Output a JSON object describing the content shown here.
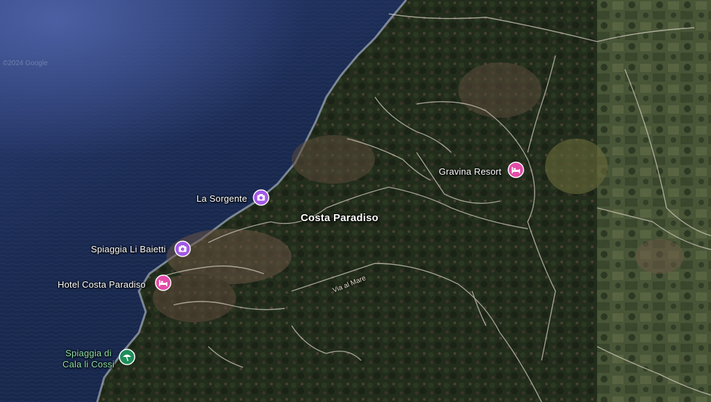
{
  "map": {
    "place_labels": {
      "town": "Costa Paradiso",
      "la_sorgente": "La Sorgente",
      "li_baietti": "Spiaggia Li Baietti",
      "hotel": "Hotel Costa Paradiso",
      "cala_li_cossi_1": "Spiaggia di",
      "cala_li_cossi_2": "Cala li Cossi",
      "gravina": "Gravina Resort"
    },
    "road_label": "Via al Mare",
    "watermark": "©2024 Google",
    "pins": {
      "la_sorgente": {
        "icon": "camera-icon",
        "color": "#a259e6"
      },
      "li_baietti": {
        "icon": "camera-icon",
        "color": "#a259e6"
      },
      "hotel": {
        "icon": "bed-icon",
        "color": "#e24ca7"
      },
      "gravina": {
        "icon": "bed-icon",
        "color": "#e24ca7"
      },
      "cala_li_cossi": {
        "icon": "beach-icon",
        "color": "#1e8e5a"
      }
    },
    "colors": {
      "sea": "#1b2a4a",
      "land_dark": "#1f2a1a",
      "land_farm": "#4a5638",
      "road": "#cfc8bb"
    }
  }
}
